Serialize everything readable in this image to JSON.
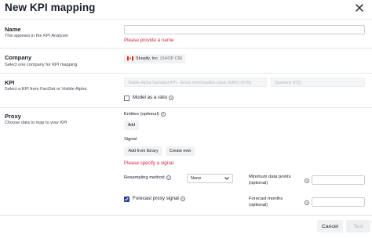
{
  "dialog": {
    "title": "New KPI mapping"
  },
  "name_section": {
    "title": "Name",
    "description": "This appears in the KPI Analyzer",
    "value": "",
    "error": "Please provide a name"
  },
  "company_section": {
    "title": "Company",
    "description": "Select one company for KPI mapping",
    "company_name": "Shopify, Inc.",
    "company_ticker": "(SHOP CN)"
  },
  "kpi_section": {
    "title": "KPI",
    "description": "Select a KPI from FactSet or Visible Alpha",
    "kpi_value": "Visible Alpha Standard KPI - Gross merchandise value (GMV) (STN)",
    "period_value": "Quarterly (FQ)",
    "ratio_label": "Model as a ratio",
    "ratio_checked": false
  },
  "proxy_section": {
    "title": "Proxy",
    "description": "Choose data to map to your KPI",
    "entities_label": "Entities (optional)",
    "add_label": "Add",
    "signal_label": "Signal",
    "add_from_library_label": "Add from library",
    "create_new_label": "Create new",
    "signal_error": "Please specify a signal",
    "resampling_label": "Resampling method",
    "resampling_value": "None",
    "forecast_label": "Forecast proxy signal",
    "forecast_checked": true,
    "min_points_label_1": "Minimum data points",
    "min_points_label_2": "(optional)",
    "min_points_value": "",
    "forecast_months_label_1": "Forecast months",
    "forecast_months_label_2": "(optional)",
    "forecast_months_value": ""
  },
  "footer": {
    "cancel_label": "Cancel",
    "test_label": "Test"
  },
  "icons": {
    "close": "close-icon",
    "help": "question-circle-icon",
    "check": "check-icon",
    "chevron": "chevron-down-icon",
    "flag": "canada-flag-icon"
  },
  "colors": {
    "error": "#d1264a",
    "accent": "#2b3f9c",
    "divider": "#e6e8ec"
  }
}
